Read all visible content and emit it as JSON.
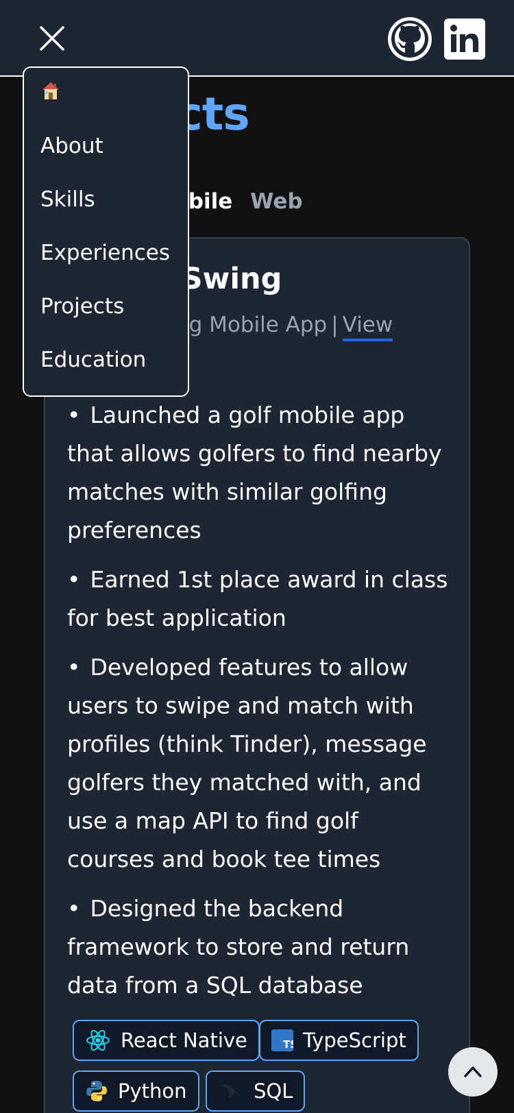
{
  "header": {
    "close_icon": "close-icon",
    "github_icon": "github-icon",
    "linkedin_icon": "linkedin-icon"
  },
  "section": {
    "title": "Projects"
  },
  "filters": {
    "tabs": [
      "Mobile",
      "Web"
    ],
    "active": "Mobile"
  },
  "project": {
    "title": "Swing",
    "subtitle": "hing Mobile App",
    "separator": "|",
    "view_label": "View",
    "bullets": [
      "Launched a golf mobile app that allows golfers to find nearby matches with similar golfing preferences",
      "Earned 1st place award in class for best application",
      "Developed features to allow users to swipe and match with profiles (think Tinder), message golfers they matched with, and use a map API to find golf courses and book tee times",
      "Designed the backend framework to store and return data from a SQL database"
    ],
    "tech": [
      {
        "label": "React Native",
        "icon": "react-icon"
      },
      {
        "label": "TypeScript",
        "icon": "typescript-icon"
      },
      {
        "label": "Python",
        "icon": "python-icon"
      },
      {
        "label": "SQL",
        "icon": "sql-icon"
      }
    ]
  },
  "menu": {
    "home_icon": "house-emoji",
    "items": [
      "About",
      "Skills",
      "Experiences",
      "Projects",
      "Education"
    ]
  },
  "scroll_top_icon": "chevron-up-icon",
  "colors": {
    "accent": "#60a5fa",
    "link_underline": "#2563eb",
    "surface": "#1e2533",
    "background": "#111111"
  }
}
